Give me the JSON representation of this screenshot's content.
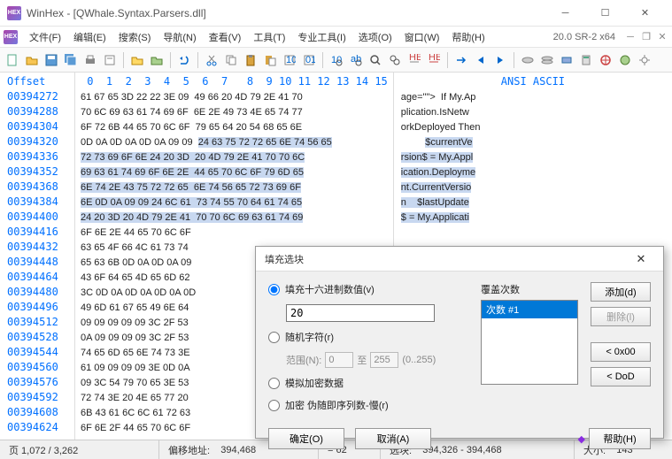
{
  "window": {
    "title": "WinHex - [QWhale.Syntax.Parsers.dll]",
    "version": "20.0 SR-2 x64"
  },
  "menu": {
    "file": "文件(F)",
    "edit": "编辑(E)",
    "search": "搜索(S)",
    "nav": "导航(N)",
    "view": "查看(V)",
    "tools": "工具(T)",
    "pro": "专业工具(I)",
    "options": "选项(O)",
    "window": "窗口(W)",
    "help": "帮助(H)"
  },
  "headers": {
    "offset": "Offset",
    "ascii": "ANSI ASCII"
  },
  "hexcols": " 0  1  2  3  4  5  6  7   8  9 10 11 12 13 14 15",
  "rows": [
    {
      "off": "00394272",
      "hex": "61 67 65 3D 22 22 3E 09  49 66 20 4D 79 2E 41 70",
      "asc": "age=\"\">  If My.Ap"
    },
    {
      "off": "00394288",
      "hex": "70 6C 69 63 61 74 69 6F  6E 2E 49 73 4E 65 74 77",
      "asc": "plication.IsNetw"
    },
    {
      "off": "00394304",
      "hex": "6F 72 6B 44 65 70 6C 6F  79 65 64 20 54 68 65 6E",
      "asc": "orkDeployed Then"
    },
    {
      "off": "00394320",
      "hex": "0D 0A 0D 0A 0D 0A 09 09  ",
      "hexsel": "24 63 75 72 72 65 6E 74 56 65",
      "asc": "         ",
      "ascsel": "$currentVe"
    },
    {
      "off": "00394336",
      "hexsel": "72 73 69 6F 6E 24 20 3D  20 4D 79 2E 41 70 70 6C",
      "ascsel": "rsion$ = My.Appl"
    },
    {
      "off": "00394352",
      "hexsel": "69 63 61 74 69 6F 6E 2E  44 65 70 6C 6F 79 6D 65",
      "ascsel": "ication.Deployme"
    },
    {
      "off": "00394368",
      "hexsel": "6E 74 2E 43 75 72 72 65  6E 74 56 65 72 73 69 6F",
      "ascsel": "nt.CurrentVersio"
    },
    {
      "off": "00394384",
      "hexsel": "6E 0D 0A 09 09 24 6C 61  73 74 55 70 64 61 74 65",
      "ascsel": "n    $lastUpdate"
    },
    {
      "off": "00394400",
      "hexsel": "24 20 3D 20 4D 79 2E 41  70 70 6C 69 63 61 74 69",
      "ascsel": "$ = My.Applicati"
    },
    {
      "off": "00394416",
      "hex": "6F 6E 2E 44 65 70 6C 6F",
      "asc": ""
    },
    {
      "off": "00394432",
      "hex": "63 65 4F 66 4C 61 73 74",
      "asc": ""
    },
    {
      "off": "00394448",
      "hex": "65 63 6B 0D 0A 0D 0A 09",
      "asc": ""
    },
    {
      "off": "00394464",
      "hex": "43 6F 64 65 4D 65 6D 62",
      "asc": ""
    },
    {
      "off": "00394480",
      "hex": "3C 0D 0A 0D 0A 0D 0A 0D",
      "asc": ""
    },
    {
      "off": "00394496",
      "hex": "49 6D 61 67 65 49 6E 64",
      "asc": ""
    },
    {
      "off": "00394512",
      "hex": "09 09 09 09 09 3C 2F 53",
      "asc": ""
    },
    {
      "off": "00394528",
      "hex": "0A 09 09 09 09 3C 2F 53",
      "asc": ""
    },
    {
      "off": "00394544",
      "hex": "74 65 6D 65 6E 74 73 3E",
      "asc": ""
    },
    {
      "off": "00394560",
      "hex": "61 09 09 09 09 3E 0D 0A",
      "asc": ""
    },
    {
      "off": "00394576",
      "hex": "09 3C 54 79 70 65 3E 53",
      "asc": ""
    },
    {
      "off": "00394592",
      "hex": "72 74 3E 20 4E 65 77 20",
      "asc": ""
    },
    {
      "off": "00394608",
      "hex": "6B 43 61 6C 6C 61 72 63",
      "asc": ""
    },
    {
      "off": "00394624",
      "hex": "6F 6E 2F 44 65 70 6C 6F",
      "asc": ""
    }
  ],
  "status": {
    "page": "页 1,072 / 3,262",
    "offlabel": "偏移地址:",
    "offval": "394,468",
    "eqlabel": "= 62",
    "sellabel": "选块:",
    "selval": "394,326 - 394,468",
    "sizelabel": "大小:",
    "sizeval": "143"
  },
  "dialog": {
    "title": "填充选块",
    "r_hex": "填充十六进制数值(v)",
    "hexval": "20",
    "r_rand": "随机字符(r)",
    "range_lbl": "范围(N):",
    "range_to": "至",
    "range_lo": "0",
    "range_hi": "255",
    "range_hint": "(0..255)",
    "r_sim": "模拟加密数据",
    "r_enc": "加密 伪随即序列数-慢(r)",
    "passes_lbl": "覆盖次数",
    "pass1": "次数 #1",
    "add": "添加(d)",
    "del": "删除(l)",
    "zero": "< 0x00",
    "dod": "< DoD",
    "ok": "确定(O)",
    "cancel": "取消(A)",
    "help": "帮助(H)"
  }
}
